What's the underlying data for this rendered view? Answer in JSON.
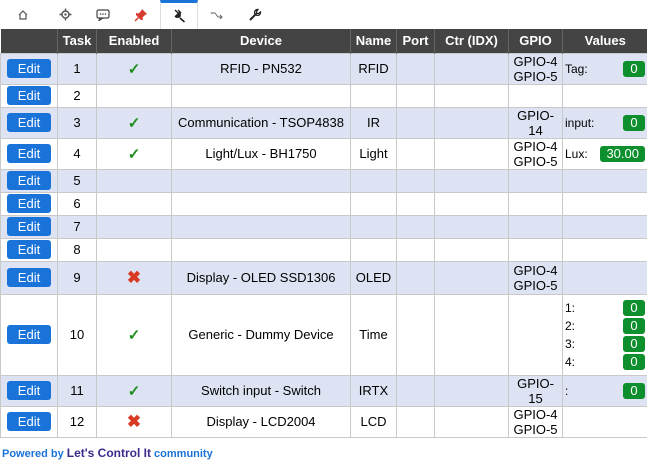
{
  "nav": {
    "tabs": [
      {
        "icon": "home-icon",
        "active": false
      },
      {
        "icon": "gear-icon",
        "active": false
      },
      {
        "icon": "controller-icon",
        "active": false
      },
      {
        "icon": "pin-icon",
        "active": false
      },
      {
        "icon": "plug-icon",
        "active": true
      },
      {
        "icon": "arrows-icon",
        "active": false
      },
      {
        "icon": "wrench-icon",
        "active": false
      }
    ]
  },
  "table": {
    "headers": [
      "",
      "Task",
      "Enabled",
      "Device",
      "Name",
      "Port",
      "Ctr (IDX)",
      "GPIO",
      "Values"
    ],
    "edit_label": "Edit",
    "rows": [
      {
        "task": "1",
        "enabled": "check",
        "device": "RFID - PN532",
        "name": "RFID",
        "port": "",
        "ctr": "",
        "gpio": [
          "GPIO-4",
          "GPIO-5"
        ],
        "values": [
          {
            "label": "Tag:",
            "value": "0"
          }
        ]
      },
      {
        "task": "2",
        "enabled": "",
        "device": "",
        "name": "",
        "port": "",
        "ctr": "",
        "gpio": [],
        "values": []
      },
      {
        "task": "3",
        "enabled": "check",
        "device": "Communication - TSOP4838",
        "name": "IR",
        "port": "",
        "ctr": "",
        "gpio": [
          "GPIO-14"
        ],
        "values": [
          {
            "label": "input:",
            "value": "0"
          }
        ]
      },
      {
        "task": "4",
        "enabled": "check",
        "device": "Light/Lux - BH1750",
        "name": "Light",
        "port": "",
        "ctr": "",
        "gpio": [
          "GPIO-4",
          "GPIO-5"
        ],
        "values": [
          {
            "label": "Lux:",
            "value": "30.00"
          }
        ]
      },
      {
        "task": "5",
        "enabled": "",
        "device": "",
        "name": "",
        "port": "",
        "ctr": "",
        "gpio": [],
        "values": []
      },
      {
        "task": "6",
        "enabled": "",
        "device": "",
        "name": "",
        "port": "",
        "ctr": "",
        "gpio": [],
        "values": []
      },
      {
        "task": "7",
        "enabled": "",
        "device": "",
        "name": "",
        "port": "",
        "ctr": "",
        "gpio": [],
        "values": []
      },
      {
        "task": "8",
        "enabled": "",
        "device": "",
        "name": "",
        "port": "",
        "ctr": "",
        "gpio": [],
        "values": []
      },
      {
        "task": "9",
        "enabled": "cross",
        "device": "Display - OLED SSD1306",
        "name": "OLED",
        "port": "",
        "ctr": "",
        "gpio": [
          "GPIO-4",
          "GPIO-5"
        ],
        "values": []
      },
      {
        "task": "10",
        "enabled": "check",
        "device": "Generic - Dummy Device",
        "name": "Time",
        "port": "",
        "ctr": "",
        "gpio": [],
        "values": [
          {
            "label": "1:",
            "value": "0"
          },
          {
            "label": "2:",
            "value": "0"
          },
          {
            "label": "3:",
            "value": "0"
          },
          {
            "label": "4:",
            "value": "0"
          }
        ]
      },
      {
        "task": "11",
        "enabled": "check",
        "device": "Switch input - Switch",
        "name": "IRTX",
        "port": "",
        "ctr": "",
        "gpio": [
          "GPIO-15"
        ],
        "values": [
          {
            "label": ":",
            "value": "0"
          }
        ]
      },
      {
        "task": "12",
        "enabled": "cross",
        "device": "Display - LCD2004",
        "name": "LCD",
        "port": "",
        "ctr": "",
        "gpio": [
          "GPIO-4",
          "GPIO-5"
        ],
        "values": []
      }
    ],
    "symbols": {
      "check": "✓",
      "cross": "✖"
    }
  },
  "footer": {
    "powered_by": "Powered by ",
    "brand": "Let's Control It",
    "suffix": " community"
  },
  "colors": {
    "accent": "#1a73d9",
    "header_bg": "#444444",
    "row_alt": "#dde3f2",
    "value_badge": "#0e8f2d"
  }
}
